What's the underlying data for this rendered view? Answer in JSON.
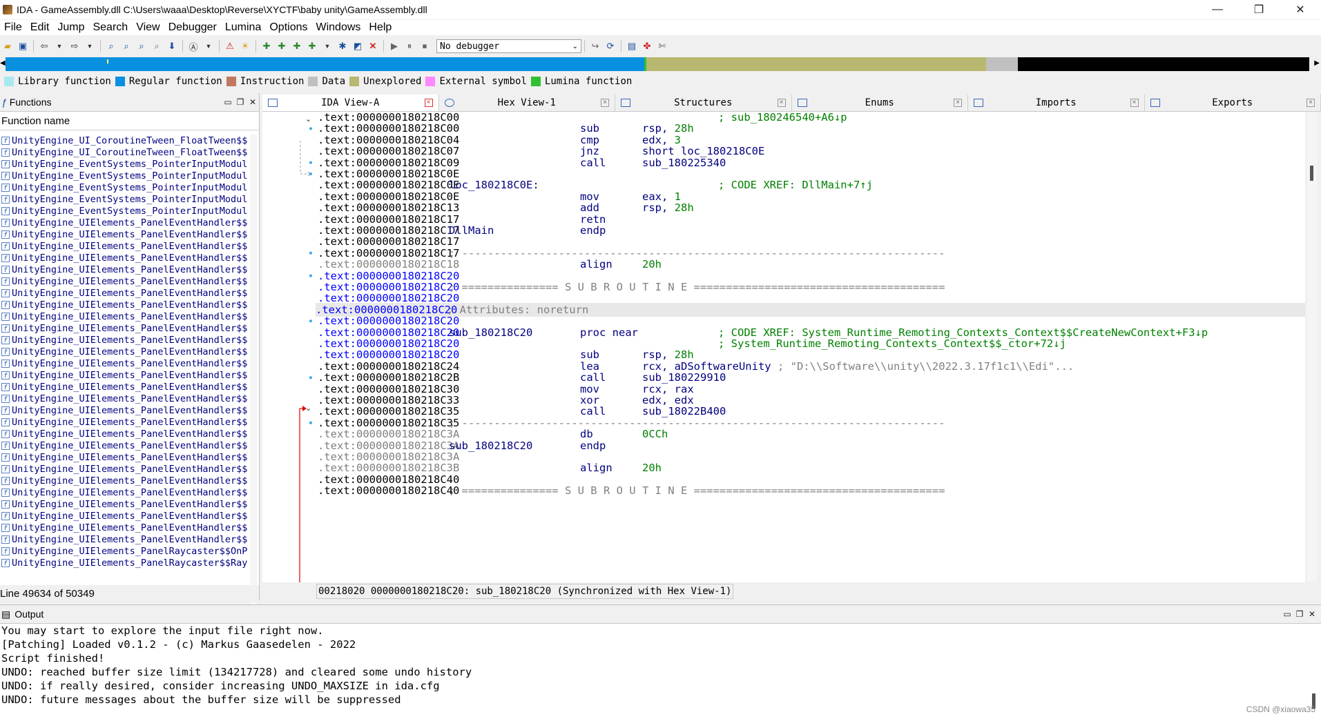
{
  "window": {
    "title": "IDA - GameAssembly.dll C:\\Users\\waaa\\Desktop\\Reverse\\XYCTF\\baby unity\\GameAssembly.dll",
    "minimize": "—",
    "restore": "❐",
    "close": "✕"
  },
  "menu": [
    "File",
    "Edit",
    "Jump",
    "Search",
    "View",
    "Debugger",
    "Lumina",
    "Options",
    "Windows",
    "Help"
  ],
  "toolbar": {
    "debugger_value": "No debugger"
  },
  "legend": [
    {
      "label": "Library function",
      "color": "#a8e8f0"
    },
    {
      "label": "Regular function",
      "color": "#0a90e0"
    },
    {
      "label": "Instruction",
      "color": "#c07860"
    },
    {
      "label": "Data",
      "color": "#c0c0c0"
    },
    {
      "label": "Unexplored",
      "color": "#b8b870"
    },
    {
      "label": "External symbol",
      "color": "#ff88ff"
    },
    {
      "label": "Lumina function",
      "color": "#30c030"
    }
  ],
  "functions_panel": {
    "title": "Functions",
    "column": "Function name",
    "items": [
      "UnityEngine_UI_CoroutineTween_FloatTween$$",
      "UnityEngine_UI_CoroutineTween_FloatTween$$",
      "UnityEngine_EventSystems_PointerInputModul",
      "UnityEngine_EventSystems_PointerInputModul",
      "UnityEngine_EventSystems_PointerInputModul",
      "UnityEngine_EventSystems_PointerInputModul",
      "UnityEngine_EventSystems_PointerInputModul",
      "UnityEngine_UIElements_PanelEventHandler$$",
      "UnityEngine_UIElements_PanelEventHandler$$",
      "UnityEngine_UIElements_PanelEventHandler$$",
      "UnityEngine_UIElements_PanelEventHandler$$",
      "UnityEngine_UIElements_PanelEventHandler$$",
      "UnityEngine_UIElements_PanelEventHandler$$",
      "UnityEngine_UIElements_PanelEventHandler$$",
      "UnityEngine_UIElements_PanelEventHandler$$",
      "UnityEngine_UIElements_PanelEventHandler$$",
      "UnityEngine_UIElements_PanelEventHandler$$",
      "UnityEngine_UIElements_PanelEventHandler$$",
      "UnityEngine_UIElements_PanelEventHandler$$",
      "UnityEngine_UIElements_PanelEventHandler$$",
      "UnityEngine_UIElements_PanelEventHandler$$",
      "UnityEngine_UIElements_PanelEventHandler$$",
      "UnityEngine_UIElements_PanelEventHandler$$",
      "UnityEngine_UIElements_PanelEventHandler$$",
      "UnityEngine_UIElements_PanelEventHandler$$",
      "UnityEngine_UIElements_PanelEventHandler$$",
      "UnityEngine_UIElements_PanelEventHandler$$",
      "UnityEngine_UIElements_PanelEventHandler$$",
      "UnityEngine_UIElements_PanelEventHandler$$",
      "UnityEngine_UIElements_PanelEventHandler$$",
      "UnityEngine_UIElements_PanelEventHandler$$",
      "UnityEngine_UIElements_PanelEventHandler$$",
      "UnityEngine_UIElements_PanelEventHandler$$",
      "UnityEngine_UIElements_PanelEventHandler$$",
      "UnityEngine_UIElements_PanelEventHandler$$",
      "UnityEngine_UIElements_PanelRaycaster$$OnP",
      "UnityEngine_UIElements_PanelRaycaster$$Ray"
    ],
    "status": "Line 49634 of 50349"
  },
  "tabs": [
    {
      "label": "IDA View-A",
      "active": true
    },
    {
      "label": "Hex View-1",
      "active": false
    },
    {
      "label": "Structures",
      "active": false
    },
    {
      "label": "Enums",
      "active": false
    },
    {
      "label": "Imports",
      "active": false
    },
    {
      "label": "Exports",
      "active": false
    }
  ],
  "disasm": [
    {
      "seg": ".text:",
      "addr": "0000000180218C00",
      "style": "t",
      "label": "",
      "mn": "",
      "ops": "",
      "comment": "; sub_180246540+A6↓p"
    },
    {
      "seg": ".text:",
      "addr": "0000000180218C00",
      "style": "t",
      "label": "",
      "mn": "sub",
      "ops": "rsp, ",
      "num": "28h",
      "comment": ""
    },
    {
      "seg": ".text:",
      "addr": "0000000180218C04",
      "style": "t",
      "label": "",
      "mn": "cmp",
      "ops": "edx, ",
      "num": "3",
      "comment": ""
    },
    {
      "seg": ".text:",
      "addr": "0000000180218C07",
      "style": "t",
      "label": "",
      "mn": "jnz",
      "ops": "short loc_180218C0E",
      "comment": ""
    },
    {
      "seg": ".text:",
      "addr": "0000000180218C09",
      "style": "t",
      "label": "",
      "mn": "call",
      "ops": "sub_180225340",
      "comment": ""
    },
    {
      "seg": ".text:",
      "addr": "0000000180218C0E",
      "style": "t",
      "label": "",
      "mn": "",
      "ops": "",
      "comment": ""
    },
    {
      "seg": ".text:",
      "addr": "0000000180218C0E",
      "style": "t",
      "label": "loc_180218C0E:",
      "mn": "",
      "ops": "",
      "comment": "; CODE XREF: DllMain+7↑j"
    },
    {
      "seg": ".text:",
      "addr": "0000000180218C0E",
      "style": "t",
      "label": "",
      "mn": "mov",
      "ops": "eax, ",
      "num": "1",
      "comment": ""
    },
    {
      "seg": ".text:",
      "addr": "0000000180218C13",
      "style": "t",
      "label": "",
      "mn": "add",
      "ops": "rsp, ",
      "num": "28h",
      "comment": ""
    },
    {
      "seg": ".text:",
      "addr": "0000000180218C17",
      "style": "t",
      "label": "",
      "mn": "retn",
      "ops": "",
      "comment": ""
    },
    {
      "seg": ".text:",
      "addr": "0000000180218C17",
      "style": "t",
      "label": "DllMain",
      "mn": "endp",
      "ops": "",
      "comment": ""
    },
    {
      "seg": ".text:",
      "addr": "0000000180218C17",
      "style": "t",
      "label": "",
      "mn": "",
      "ops": "",
      "comment": ""
    },
    {
      "seg": ".text:",
      "addr": "0000000180218C17",
      "style": "t",
      "label": "",
      "mn": "",
      "ops": "",
      "comment": "",
      "raw": "; ---------------------------------------------------------------------------"
    },
    {
      "seg": ".text:",
      "addr": "0000000180218C18",
      "style": "g",
      "label": "",
      "mn": "align",
      "ops": "",
      "num": "20h",
      "comment": ""
    },
    {
      "seg": ".text:",
      "addr": "0000000180218C20",
      "style": "b",
      "label": "",
      "mn": "",
      "ops": "",
      "comment": ""
    },
    {
      "seg": ".text:",
      "addr": "0000000180218C20",
      "style": "b",
      "label": "",
      "mn": "",
      "ops": "",
      "comment": "",
      "raw": "; =============== S U B R O U T I N E ======================================="
    },
    {
      "seg": ".text:",
      "addr": "0000000180218C20",
      "style": "b",
      "label": "",
      "mn": "",
      "ops": "",
      "comment": ""
    },
    {
      "seg": ".text:",
      "addr": "0000000180218C20",
      "style": "b",
      "label": "",
      "mn": "",
      "ops": "",
      "comment": "",
      "raw": "; Attributes: noreturn",
      "hl": true
    },
    {
      "seg": ".text:",
      "addr": "0000000180218C20",
      "style": "b",
      "label": "",
      "mn": "",
      "ops": "",
      "comment": ""
    },
    {
      "seg": ".text:",
      "addr": "0000000180218C20",
      "style": "b",
      "label": "sub_180218C20",
      "mn": "proc near",
      "ops": "",
      "comment": "; CODE XREF: System_Runtime_Remoting_Contexts_Context$$CreateNewContext+F3↓p"
    },
    {
      "seg": ".text:",
      "addr": "0000000180218C20",
      "style": "b",
      "label": "",
      "mn": "",
      "ops": "",
      "comment": "; System_Runtime_Remoting_Contexts_Context$$_ctor+72↓j"
    },
    {
      "seg": ".text:",
      "addr": "0000000180218C20",
      "style": "b",
      "label": "",
      "mn": "sub",
      "ops": "rsp, ",
      "num": "28h",
      "comment": ""
    },
    {
      "seg": ".text:",
      "addr": "0000000180218C24",
      "style": "t",
      "label": "",
      "mn": "lea",
      "ops": "rcx, aDSoftwareUnity",
      "comment": "",
      "str": " ; \"D:\\\\Software\\\\unity\\\\2022.3.17f1c1\\\\Edi\"..."
    },
    {
      "seg": ".text:",
      "addr": "0000000180218C2B",
      "style": "t",
      "label": "",
      "mn": "call",
      "ops": "sub_180229910",
      "comment": ""
    },
    {
      "seg": ".text:",
      "addr": "0000000180218C30",
      "style": "t",
      "label": "",
      "mn": "mov",
      "ops": "rcx, rax",
      "comment": ""
    },
    {
      "seg": ".text:",
      "addr": "0000000180218C33",
      "style": "t",
      "label": "",
      "mn": "xor",
      "ops": "edx, edx",
      "comment": ""
    },
    {
      "seg": ".text:",
      "addr": "0000000180218C35",
      "style": "t",
      "label": "",
      "mn": "call",
      "ops": "sub_18022B400",
      "comment": ""
    },
    {
      "seg": ".text:",
      "addr": "0000000180218C35",
      "style": "t",
      "label": "",
      "mn": "",
      "ops": "",
      "comment": "",
      "raw": "; ---------------------------------------------------------------------------"
    },
    {
      "seg": ".text:",
      "addr": "0000000180218C3A",
      "style": "g",
      "label": "",
      "mn": "db",
      "ops": "",
      "num": "0CCh",
      "comment": ""
    },
    {
      "seg": ".text:",
      "addr": "0000000180218C3A",
      "style": "g",
      "label": "sub_180218C20",
      "mn": "endp",
      "ops": "",
      "comment": ""
    },
    {
      "seg": ".text:",
      "addr": "0000000180218C3A",
      "style": "g",
      "label": "",
      "mn": "",
      "ops": "",
      "comment": ""
    },
    {
      "seg": ".text:",
      "addr": "0000000180218C3B",
      "style": "g",
      "label": "",
      "mn": "align",
      "ops": "",
      "num": "20h",
      "comment": ""
    },
    {
      "seg": ".text:",
      "addr": "0000000180218C40",
      "style": "t",
      "label": "",
      "mn": "",
      "ops": "",
      "comment": ""
    },
    {
      "seg": ".text:",
      "addr": "0000000180218C40",
      "style": "t",
      "label": "",
      "mn": "",
      "ops": "",
      "comment": "",
      "raw": "; =============== S U B R O U T I N E ======================================="
    }
  ],
  "disasm_status": "00218020 0000000180218C20: sub_180218C20 (Synchronized with Hex View-1)",
  "output": {
    "title": "Output",
    "lines": [
      "You may start to explore the input file right now.",
      "[Patching] Loaded v0.1.2 - (c) Markus Gaasedelen - 2022",
      "Script finished!",
      "UNDO: reached buffer size limit (134217728) and cleared some undo history",
      "UNDO: if really desired, consider increasing UNDO_MAXSIZE in ida.cfg",
      "UNDO: future messages about the buffer size will be suppressed"
    ]
  },
  "watermark": "CSDN @xiaowa35"
}
